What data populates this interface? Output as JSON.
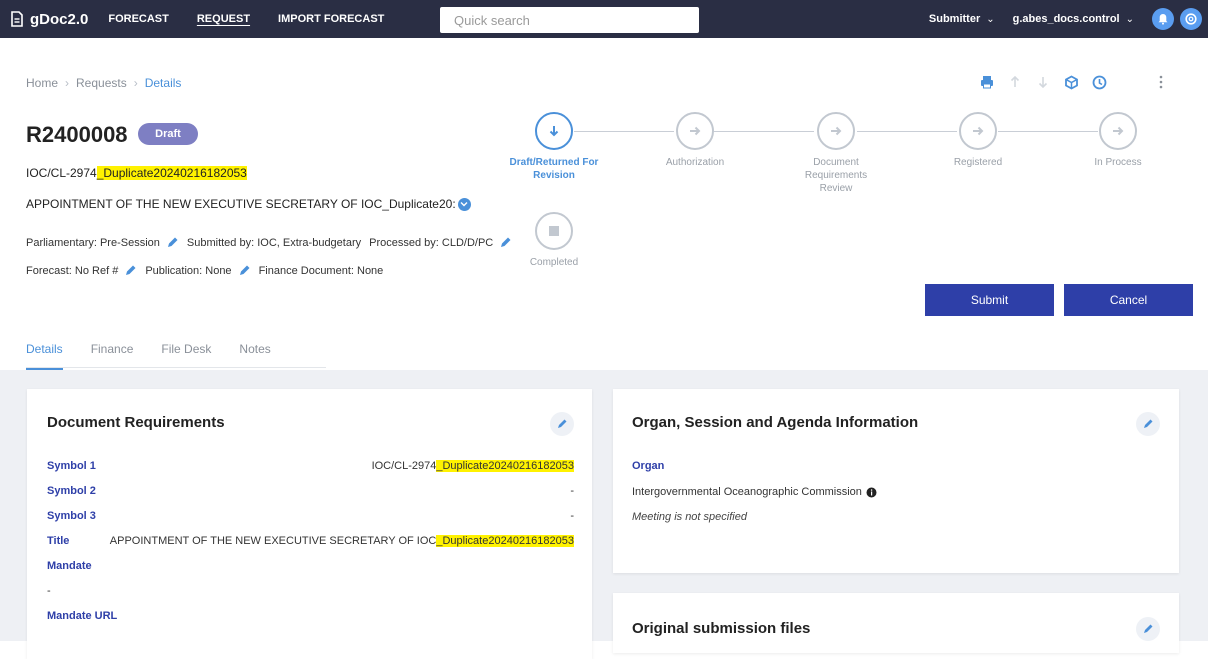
{
  "topbar": {
    "brand": "gDoc2.0",
    "nav": [
      "FORECAST",
      "REQUEST",
      "IMPORT FORECAST"
    ],
    "search_placeholder": "Quick search",
    "role": "Submitter",
    "user": "g.abes_docs.control"
  },
  "breadcrumb": {
    "home": "Home",
    "requests": "Requests",
    "details": "Details"
  },
  "request": {
    "id": "R2400008",
    "status": "Draft",
    "symbol_prefix": "IOC/CL-2974",
    "symbol_suffix": "_Duplicate20240216182053",
    "title": "APPOINTMENT OF THE NEW EXECUTIVE SECRETARY OF IOC_Duplicate20:"
  },
  "meta": {
    "parliamentary": "Parliamentary: Pre-Session",
    "submitted_by": "Submitted by: IOC, Extra-budgetary",
    "processed_by": "Processed by: CLD/D/PC",
    "forecast": "Forecast: No Ref #",
    "publication": "Publication: None",
    "finance_document": "Finance Document: None"
  },
  "steps": [
    "Draft/Returned For Revision",
    "Authorization",
    "Document Requirements Review",
    "Registered",
    "In Process",
    "Completed"
  ],
  "actions": {
    "submit": "Submit",
    "cancel": "Cancel"
  },
  "tabs": [
    "Details",
    "Finance",
    "File Desk",
    "Notes"
  ],
  "doc_requirements": {
    "title": "Document Requirements",
    "symbol1_label": "Symbol 1",
    "symbol1_prefix": "IOC/CL-2974",
    "symbol1_suffix": "_Duplicate20240216182053",
    "symbol2_label": "Symbol 2",
    "symbol2_value": "-",
    "symbol3_label": "Symbol 3",
    "symbol3_value": "-",
    "title_label": "Title",
    "title_prefix": "APPOINTMENT OF THE NEW EXECUTIVE SECRETARY OF IOC",
    "title_suffix": "_Duplicate20240216182053",
    "mandate_label": "Mandate",
    "mandate_value": "-",
    "mandate_url_label": "Mandate URL"
  },
  "organ_card": {
    "title": "Organ, Session and Agenda Information",
    "organ_label": "Organ",
    "organ_value": "Intergovernmental Oceanographic Commission",
    "meeting_note": "Meeting is not specified"
  },
  "files_card": {
    "title": "Original submission files"
  }
}
